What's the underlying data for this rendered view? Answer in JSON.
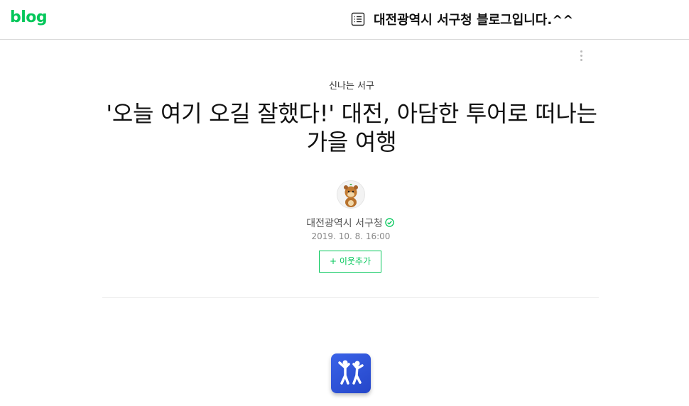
{
  "header": {
    "logo": "blog",
    "blog_title": "대전광역시 서구청 블로그입니다.^^"
  },
  "post": {
    "category": "신나는 서구",
    "title": "'오늘 여기 오길 잘했다!' 대전, 아담한 투어로 떠나는 가을 여행",
    "author": "대전광역시 서구청",
    "date": "2019. 10. 8. 16:00",
    "neighbor_button": "+ 이웃추가"
  },
  "icons": {
    "list": "list-icon",
    "more": "more-vertical-icon",
    "verified": "verified-check-icon",
    "avatar": "mascot-avatar",
    "app": "dancing-people-icon"
  },
  "colors": {
    "brand": "#03c75a",
    "app_icon": "#2e55d6"
  }
}
